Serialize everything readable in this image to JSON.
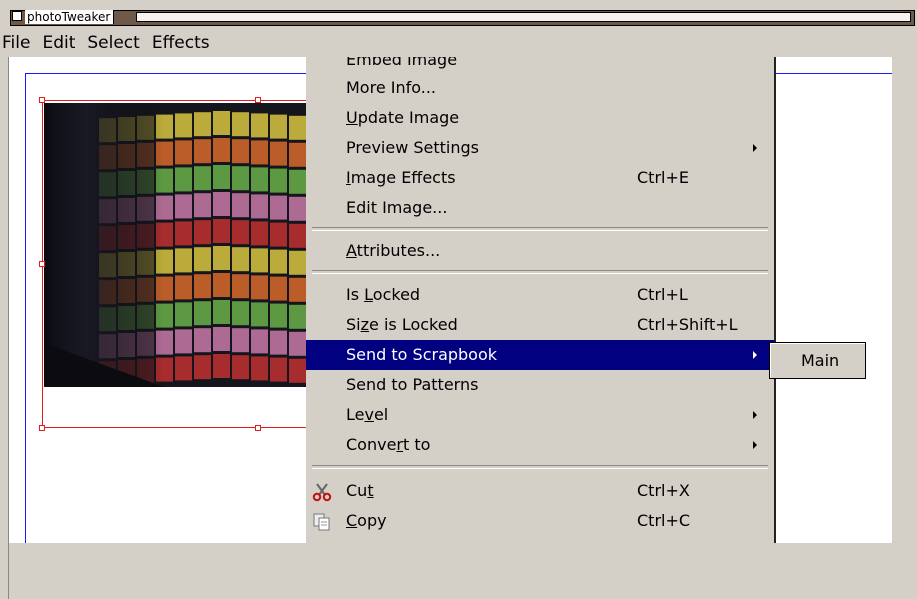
{
  "window": {
    "title": "photoTweaker"
  },
  "menubar": {
    "items": [
      "File",
      "Edit",
      "Select",
      "Effects"
    ]
  },
  "context_menu": {
    "items": [
      {
        "label": "Embed Image",
        "shortcut": "",
        "submenu": false
      },
      {
        "label": "More Info...",
        "shortcut": "",
        "submenu": false
      },
      {
        "label_pre": "",
        "label_u": "U",
        "label_post": "pdate Image",
        "shortcut": "",
        "submenu": false
      },
      {
        "label": "Preview Settings",
        "shortcut": "",
        "submenu": true
      },
      {
        "label_pre": "",
        "label_u": "I",
        "label_post": "mage Effects",
        "shortcut": "Ctrl+E",
        "submenu": false
      },
      {
        "label": "Edit Image...",
        "shortcut": "",
        "submenu": false
      },
      {
        "label_pre": "",
        "label_u": "A",
        "label_post": "ttributes...",
        "shortcut": "",
        "submenu": false
      },
      {
        "label_pre": "Is ",
        "label_u": "L",
        "label_post": "ocked",
        "shortcut": "Ctrl+L",
        "submenu": false
      },
      {
        "label_pre": "Si",
        "label_u": "z",
        "label_post": "e is Locked",
        "shortcut": "Ctrl+Shift+L",
        "submenu": false
      },
      {
        "label": "Send to Scrapbook",
        "shortcut": "",
        "submenu": true,
        "highlighted": true
      },
      {
        "label": "Send to Patterns",
        "shortcut": "",
        "submenu": false
      },
      {
        "label_pre": "Le",
        "label_u": "v",
        "label_post": "el",
        "shortcut": "",
        "submenu": true
      },
      {
        "label_pre": "Conve",
        "label_u": "r",
        "label_post": "t to",
        "shortcut": "",
        "submenu": true
      },
      {
        "label_pre": "Cu",
        "label_u": "t",
        "label_post": "",
        "shortcut": "Ctrl+X",
        "submenu": false,
        "icon": "scissors-icon"
      },
      {
        "label_pre": "",
        "label_u": "C",
        "label_post": "opy",
        "shortcut": "Ctrl+C",
        "submenu": false,
        "icon": "copy-icon"
      }
    ]
  },
  "submenu": {
    "items": [
      "Main"
    ]
  },
  "colors": {
    "highlight": "#000080",
    "frame": "#e02020",
    "page_border": "#1a1aff",
    "menu_bg": "#d4d0c8"
  }
}
